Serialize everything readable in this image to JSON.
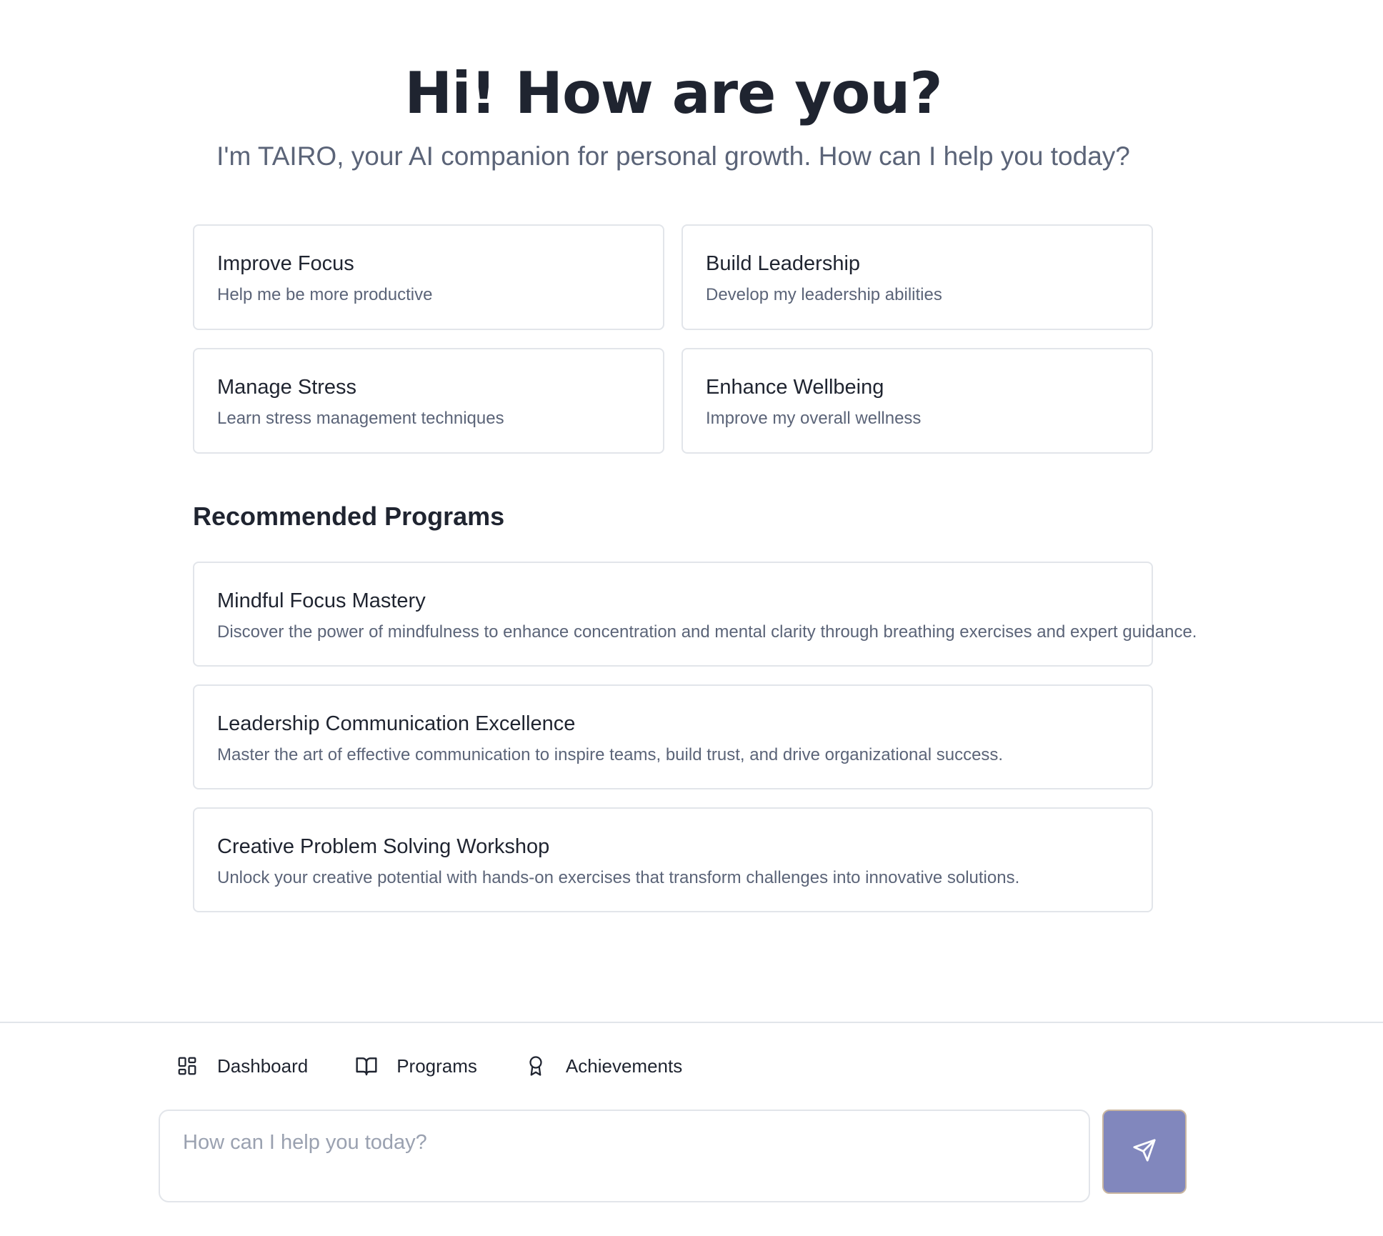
{
  "hero": {
    "title": "Hi! How are you?",
    "subtitle": "I'm TAIRO, your AI companion for personal growth. How can I help you today?"
  },
  "quick_actions": [
    {
      "title": "Improve Focus",
      "description": "Help me be more productive"
    },
    {
      "title": "Build Leadership",
      "description": "Develop my leadership abilities"
    },
    {
      "title": "Manage Stress",
      "description": "Learn stress management techniques"
    },
    {
      "title": "Enhance Wellbeing",
      "description": "Improve my overall wellness"
    }
  ],
  "recommended": {
    "heading": "Recommended Programs",
    "programs": [
      {
        "title": "Mindful Focus Mastery",
        "description": "Discover the power of mindfulness to enhance concentration and mental clarity through breathing exercises and expert guidance."
      },
      {
        "title": "Leadership Communication Excellence",
        "description": "Master the art of effective communication to inspire teams, build trust, and drive organizational success."
      },
      {
        "title": "Creative Problem Solving Workshop",
        "description": "Unlock your creative potential with hands-on exercises that transform challenges into innovative solutions."
      }
    ]
  },
  "nav": {
    "items": [
      {
        "label": "Dashboard",
        "icon": "dashboard-icon"
      },
      {
        "label": "Programs",
        "icon": "book-icon"
      },
      {
        "label": "Achievements",
        "icon": "award-icon"
      }
    ]
  },
  "chat": {
    "placeholder": "How can I help you today?",
    "send_icon": "send-icon"
  },
  "colors": {
    "text": "#1f2430",
    "muted": "#5b6478",
    "border": "#e2e5ea",
    "send_button": "#8187bd"
  }
}
